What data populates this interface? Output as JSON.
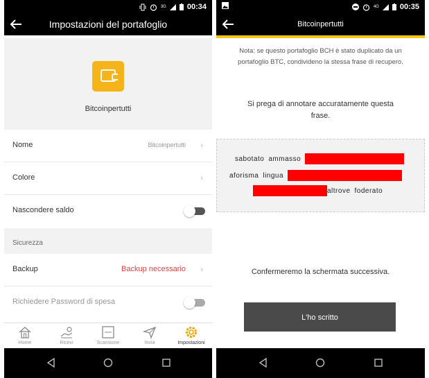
{
  "left": {
    "status": {
      "time": "00:34",
      "signal": "3G"
    },
    "appbar": {
      "title": "Impostazioni del portafoglio",
      "back_icon": "arrow-left-icon"
    },
    "wallet": {
      "name": "Bitcoinpertutti",
      "logo_icon": "wallet-bch-icon",
      "logo_color": "#f5b41a"
    },
    "rows": {
      "name": {
        "label": "Nome",
        "value": "Bitcoinpertutti"
      },
      "color": {
        "label": "Colore"
      },
      "hide_balance": {
        "label": "Nascondere saldo",
        "on": false
      },
      "security_section": "Sicurezza",
      "backup": {
        "label": "Backup",
        "value": "Backup necessario"
      },
      "spending_password": {
        "label": "Richiedere Password di spesa",
        "on": false
      }
    },
    "tabs": [
      {
        "label": "Home",
        "icon": "home-icon"
      },
      {
        "label": "Ricevi",
        "icon": "receive-icon"
      },
      {
        "label": "Scansione",
        "icon": "scan-icon"
      },
      {
        "label": "Invia",
        "icon": "send-icon"
      },
      {
        "label": "Impostazioni",
        "icon": "gear-icon",
        "active": true
      }
    ],
    "accent_color": "#f5c518"
  },
  "right": {
    "status": {
      "time": "00:35",
      "signal": "4G"
    },
    "appbar": {
      "title": "Bitcoinpertutti",
      "back_icon": "arrow-left-icon"
    },
    "note": "Nota: se questo portafoglio BCH è stato duplicato da un portafoglio BTC, condivideno la stessa frase di recupero.",
    "instructions": "Si prega di annotare accuratamente questa frase.",
    "words": {
      "line1": [
        "sabotato",
        "ammasso"
      ],
      "line2": [
        "aforisma",
        "lingua"
      ],
      "line3": [
        "altrove",
        "foderato"
      ]
    },
    "confirm_text": "Confermeremo la schermata successiva.",
    "button": "L'ho scritto",
    "redaction_color": "#ff0000"
  }
}
